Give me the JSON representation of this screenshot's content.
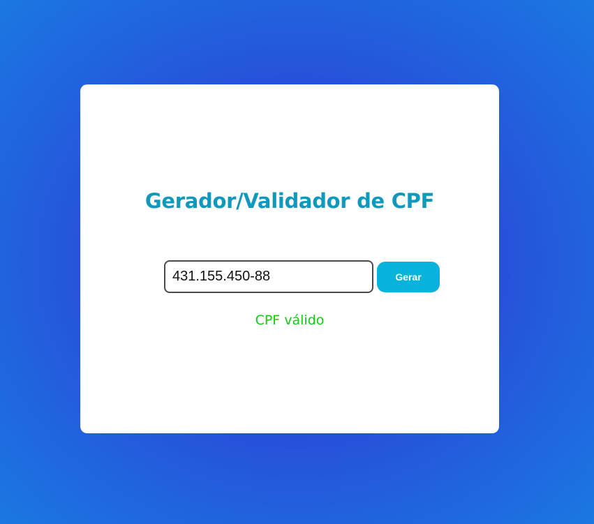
{
  "app": {
    "title": "Gerador/Validador de CPF"
  },
  "form": {
    "cpf_value": "431.155.450-88",
    "generate_label": "Gerar"
  },
  "result": {
    "message": "CPF válido",
    "status": "valid"
  },
  "colors": {
    "title": "#1199bd",
    "button": "#05b3db",
    "valid_text": "#11cc11"
  }
}
